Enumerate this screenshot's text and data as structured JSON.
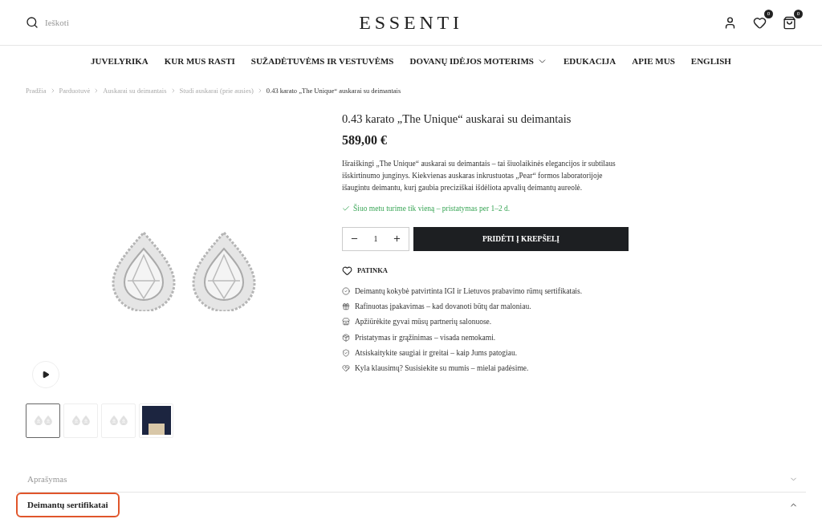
{
  "header": {
    "search_placeholder": "Ieškoti",
    "logo": "ESSENTI",
    "wishlist_count": "0",
    "cart_count": "0"
  },
  "nav": [
    {
      "label": "JUVELYRIKA",
      "dropdown": false
    },
    {
      "label": "KUR MUS RASTI",
      "dropdown": false
    },
    {
      "label": "SUŽADĖTUVĖMS IR VESTUVĖMS",
      "dropdown": false
    },
    {
      "label": "DOVANŲ IDĖJOS MOTERIMS",
      "dropdown": true
    },
    {
      "label": "EDUKACIJA",
      "dropdown": false
    },
    {
      "label": "APIE MUS",
      "dropdown": false
    },
    {
      "label": "ENGLISH",
      "dropdown": false
    }
  ],
  "breadcrumbs": [
    "Pradžia",
    "Parduotuvė",
    "Auskarai su deimantais",
    "Studi auskarai (prie ausies)",
    "0.43 karato „The Unique“ auskarai su deimantais"
  ],
  "thumbnails": [
    {
      "kind": "earrings",
      "selected": true
    },
    {
      "kind": "earrings",
      "selected": false
    },
    {
      "kind": "earrings",
      "selected": false
    },
    {
      "kind": "photo",
      "selected": false
    }
  ],
  "product": {
    "title": "0.43 karato „The Unique“ auskarai su deimantais",
    "price": "589,00 €",
    "description": "Išraiškingi „The Unique“ auskarai su deimantais – tai šiuolaikinės elegancijos ir subtilaus išskirtinumo junginys. Kiekvienas auskaras inkrustuotas „Pear“ formos laboratorijoje išaugintu deimantu, kurį gaubia preciziškai išdėliota apvalių deimantų aureolė.",
    "stock": "Šiuo metu turime tik vieną – pristatymas per 1–2 d.",
    "quantity": "1",
    "add_to_cart": "PRIDĖTI Į KREPŠELĮ",
    "wishlist": "PATINKA"
  },
  "features": [
    "Deimantų kokybė patvirtinta IGI ir Lietuvos prabavimo rūmų sertifikatais.",
    "Rafinuotas įpakavimas – kad dovanoti būtų dar maloniau.",
    "Apžiūrėkite gyvai mūsų partnerių salonuose.",
    "Pristatymas ir grąžinimas – visada nemokami.",
    "Atsiskaitykite saugiai ir greitai – kaip Jums patogiau.",
    "Kyla klausimų? Susisiekite su mumis – mielai padėsime."
  ],
  "accordion": [
    {
      "label": "Aprašymas",
      "expanded": false,
      "selected": false
    },
    {
      "label": "Deimantų sertifikatai",
      "expanded": true,
      "selected": true
    }
  ]
}
